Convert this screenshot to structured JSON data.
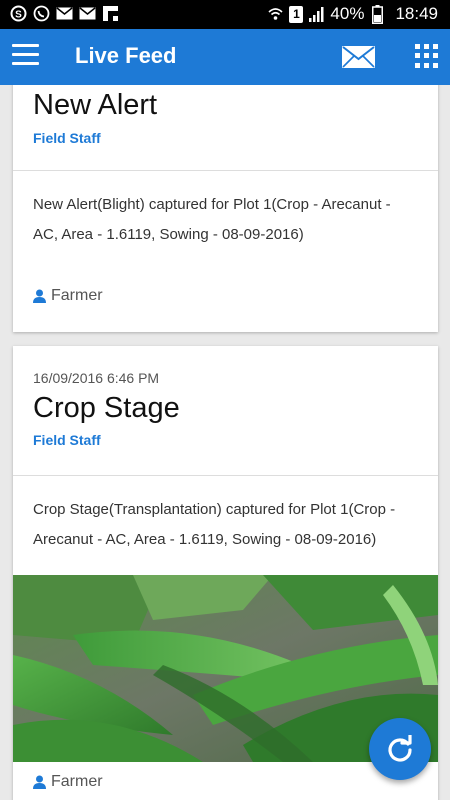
{
  "status_bar": {
    "battery": "40%",
    "time": "18:49",
    "sim_slot": "1"
  },
  "app_bar": {
    "title": "Live Feed"
  },
  "feed": {
    "items": [
      {
        "date": "",
        "title": "New Alert",
        "subtitle": "Field Staff",
        "description": "New Alert(Blight) captured for Plot 1(Crop - Arecanut - AC, Area - 1.6119, Sowing - 08-09-2016)",
        "user": "Farmer"
      },
      {
        "date": "16/09/2016 6:46 PM",
        "title": "Crop Stage",
        "subtitle": "Field Staff",
        "description": "Crop Stage(Transplantation) captured for Plot 1(Crop - Arecanut - AC, Area - 1.6119, Sowing - 08-09-2016)",
        "user": "Farmer"
      }
    ]
  },
  "colors": {
    "primary": "#1e7ad6",
    "background": "#e9e9e9"
  }
}
